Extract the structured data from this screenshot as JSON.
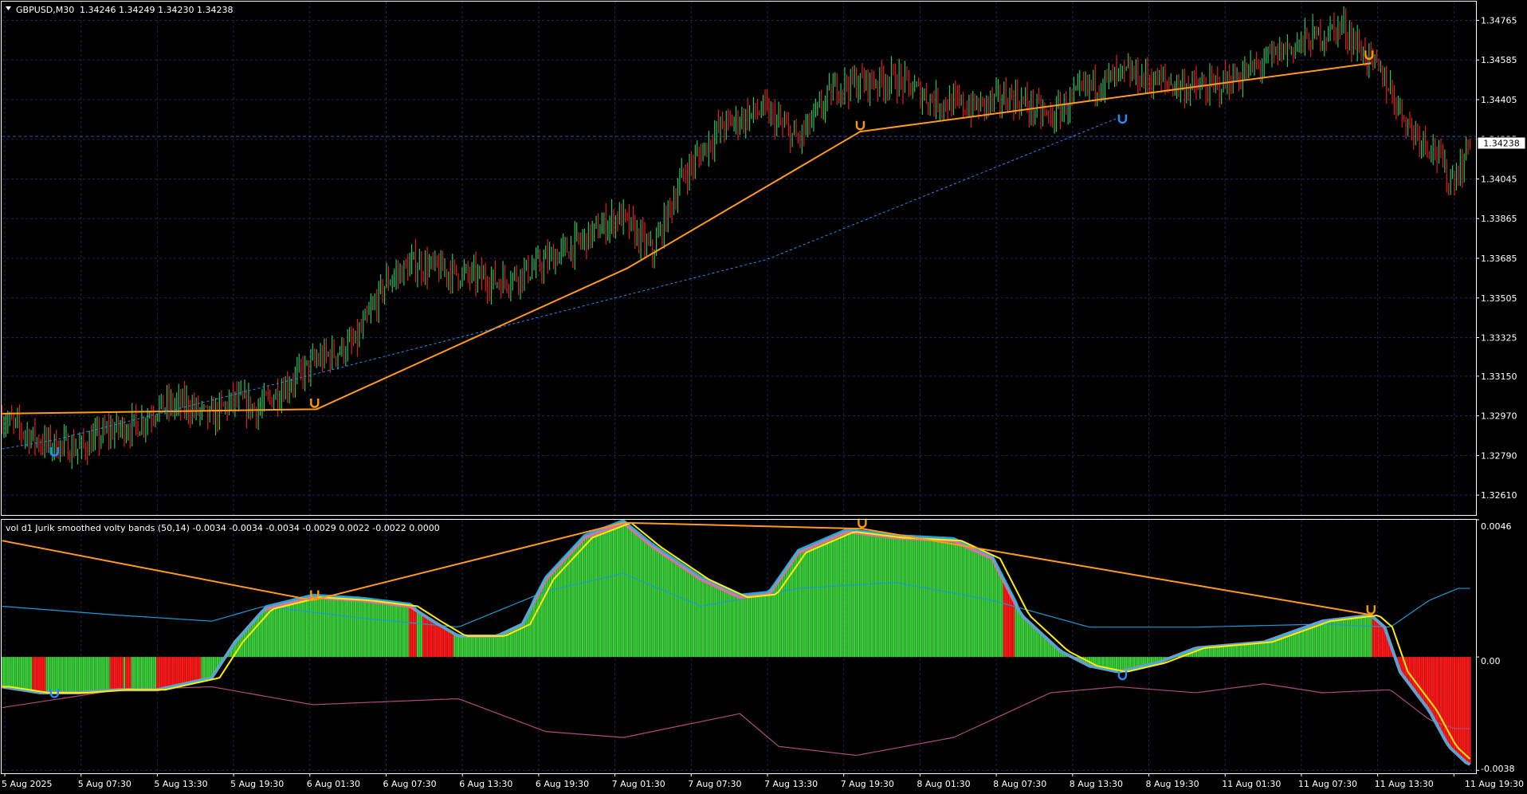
{
  "window": {
    "title": "GBPUSD,M30",
    "quote": "1.34246 1.34249 1.34230 1.34238",
    "current_price": "1.34238"
  },
  "indicator": {
    "title": "vol d1 Jurik smoothed volty bands (50,14) -0.0034 -0.0034 -0.0034 -0.0029 0.0022 -0.0022 0.0000",
    "y_labels": [
      "0.0046",
      "0.00",
      "-0.0038"
    ]
  },
  "chart_data": [
    {
      "type": "candlestick",
      "symbol": "GBPUSD",
      "timeframe": "M30",
      "ylim": [
        1.3252,
        1.3485
      ],
      "y_ticks": [
        "1.34765",
        "1.34585",
        "1.34405",
        "1.34225",
        "1.34045",
        "1.33865",
        "1.33685",
        "1.33505",
        "1.33325",
        "1.33150",
        "1.32970",
        "1.32790",
        "1.32610"
      ],
      "x_ticks": [
        "5 Aug 2025",
        "5 Aug 07:30",
        "5 Aug 13:30",
        "5 Aug 19:30",
        "6 Aug 01:30",
        "6 Aug 07:30",
        "6 Aug 13:30",
        "6 Aug 19:30",
        "7 Aug 01:30",
        "7 Aug 07:30",
        "7 Aug 13:30",
        "7 Aug 19:30",
        "8 Aug 01:30",
        "8 Aug 07:30",
        "8 Aug 13:30",
        "8 Aug 19:30",
        "11 Aug 01:30",
        "11 Aug 07:30",
        "11 Aug 13:30",
        "11 Aug 19:30"
      ],
      "current_price": 1.34238,
      "bull_color": "#22c55e",
      "bear_color": "#e11d1d",
      "close_path": [
        [
          0,
          1.3296
        ],
        [
          20,
          1.3285
        ],
        [
          40,
          1.3282
        ],
        [
          55,
          1.329
        ],
        [
          70,
          1.3293
        ],
        [
          80,
          1.3301
        ],
        [
          95,
          1.3302
        ],
        [
          107,
          1.3296
        ],
        [
          120,
          1.3304
        ],
        [
          132,
          1.33
        ],
        [
          145,
          1.331
        ],
        [
          162,
          1.3322
        ],
        [
          182,
          1.333
        ],
        [
          198,
          1.3358
        ],
        [
          212,
          1.3366
        ],
        [
          232,
          1.3362
        ],
        [
          256,
          1.3358
        ],
        [
          274,
          1.3364
        ],
        [
          298,
          1.3376
        ],
        [
          318,
          1.3388
        ],
        [
          335,
          1.3371
        ],
        [
          350,
          1.3405
        ],
        [
          370,
          1.3428
        ],
        [
          392,
          1.3436
        ],
        [
          410,
          1.3422
        ],
        [
          430,
          1.3447
        ],
        [
          460,
          1.345
        ],
        [
          480,
          1.344
        ],
        [
          500,
          1.3437
        ],
        [
          520,
          1.3442
        ],
        [
          540,
          1.3432
        ],
        [
          560,
          1.3447
        ],
        [
          580,
          1.3452
        ],
        [
          600,
          1.3448
        ],
        [
          620,
          1.3445
        ],
        [
          640,
          1.3452
        ],
        [
          660,
          1.3463
        ],
        [
          680,
          1.347
        ],
        [
          690,
          1.3474
        ],
        [
          700,
          1.3463
        ],
        [
          712,
          1.345
        ],
        [
          725,
          1.3428
        ],
        [
          738,
          1.3418
        ],
        [
          745,
          1.3404
        ],
        [
          752,
          1.341
        ],
        [
          756,
          1.3424
        ]
      ],
      "zigzag": [
        [
          0,
          1.3298
        ],
        [
          162,
          1.33
        ],
        [
          322,
          1.3364
        ],
        [
          442,
          1.3426
        ],
        [
          705,
          1.3457
        ]
      ],
      "dashed": [
        [
          0,
          1.3282
        ],
        [
          27,
          1.3286
        ],
        [
          394,
          1.3368
        ],
        [
          577,
          1.3433
        ]
      ],
      "arrows": [
        {
          "x": 27,
          "price": 1.3281,
          "color": "#1e90ff"
        },
        {
          "x": 161,
          "price": 1.3303,
          "color": "#ff9900"
        },
        {
          "x": 442,
          "price": 1.3429,
          "color": "#ff9900"
        },
        {
          "x": 577,
          "price": 1.3432,
          "color": "#1e90ff"
        },
        {
          "x": 704,
          "price": 1.3461,
          "color": "#ff9900"
        }
      ]
    },
    {
      "type": "histogram",
      "name": "vol d1 Jurik smoothed volty bands (50,14)",
      "ylim": [
        -0.0039,
        0.0046
      ],
      "y_ticks": [
        0.0046,
        0.0,
        -0.0038
      ],
      "pos_color": "#3ccf3c",
      "neg_color": "#ff1a1a",
      "values_path": [
        [
          0,
          -0.001
        ],
        [
          20,
          -0.0012
        ],
        [
          40,
          -0.0012
        ],
        [
          60,
          -0.0011
        ],
        [
          80,
          -0.0011
        ],
        [
          108,
          -0.0007
        ],
        [
          120,
          0.0005
        ],
        [
          135,
          0.0016
        ],
        [
          160,
          0.002
        ],
        [
          185,
          0.0019
        ],
        [
          210,
          0.0017
        ],
        [
          222,
          0.0012
        ],
        [
          235,
          0.0007
        ],
        [
          255,
          0.0007
        ],
        [
          268,
          0.0011
        ],
        [
          280,
          0.0026
        ],
        [
          300,
          0.004
        ],
        [
          320,
          0.0045
        ],
        [
          335,
          0.0037
        ],
        [
          360,
          0.0026
        ],
        [
          380,
          0.002
        ],
        [
          395,
          0.0021
        ],
        [
          410,
          0.0035
        ],
        [
          435,
          0.0042
        ],
        [
          460,
          0.004
        ],
        [
          490,
          0.0039
        ],
        [
          510,
          0.0033
        ],
        [
          525,
          0.0014
        ],
        [
          545,
          0.0002
        ],
        [
          560,
          -0.0003
        ],
        [
          575,
          -0.0005
        ],
        [
          595,
          -0.0002
        ],
        [
          615,
          0.0003
        ],
        [
          650,
          0.0005
        ],
        [
          680,
          0.0012
        ],
        [
          705,
          0.0014
        ],
        [
          712,
          0.001
        ],
        [
          720,
          -0.0005
        ],
        [
          735,
          -0.0018
        ],
        [
          745,
          -0.003
        ],
        [
          755,
          -0.0036
        ]
      ],
      "negative_spans": [
        [
          16,
          22
        ],
        [
          56,
          62
        ],
        [
          64,
          66
        ],
        [
          80,
          102
        ],
        [
          210,
          213
        ],
        [
          217,
          232
        ],
        [
          516,
          521
        ],
        [
          706,
          756
        ]
      ],
      "zigzag": [
        [
          0,
          0.0039
        ],
        [
          160,
          0.0019
        ],
        [
          320,
          0.0045
        ],
        [
          443,
          0.0043
        ],
        [
          706,
          0.0014
        ]
      ],
      "arrows": [
        {
          "x": 27,
          "value": -0.0012,
          "color": "#1e90ff"
        },
        {
          "x": 161,
          "value": 0.0021,
          "color": "#ff9900"
        },
        {
          "x": 443,
          "value": 0.0045,
          "color": "#ff9900"
        },
        {
          "x": 577,
          "value": -0.0006,
          "color": "#1e90ff"
        },
        {
          "x": 705,
          "value": 0.0016,
          "color": "#ff9900"
        }
      ],
      "upper_band_path": [
        [
          0,
          0.0017
        ],
        [
          60,
          0.0014
        ],
        [
          108,
          0.0012
        ],
        [
          135,
          0.0017
        ],
        [
          185,
          0.0013
        ],
        [
          235,
          0.001
        ],
        [
          280,
          0.0022
        ],
        [
          320,
          0.0028
        ],
        [
          360,
          0.0017
        ],
        [
          410,
          0.0023
        ],
        [
          460,
          0.0025
        ],
        [
          510,
          0.0019
        ],
        [
          560,
          0.001
        ],
        [
          615,
          0.001
        ],
        [
          680,
          0.0011
        ],
        [
          715,
          0.001
        ],
        [
          735,
          0.0019
        ],
        [
          750,
          0.0023
        ]
      ],
      "lower_band_path": [
        [
          0,
          -0.0017
        ],
        [
          60,
          -0.0011
        ],
        [
          108,
          -0.001
        ],
        [
          160,
          -0.0016
        ],
        [
          235,
          -0.0014
        ],
        [
          280,
          -0.0025
        ],
        [
          320,
          -0.0027
        ],
        [
          380,
          -0.0019
        ],
        [
          400,
          -0.003
        ],
        [
          440,
          -0.0033
        ],
        [
          490,
          -0.0027
        ],
        [
          540,
          -0.0012
        ],
        [
          575,
          -0.001
        ],
        [
          615,
          -0.0012
        ],
        [
          650,
          -0.0009
        ],
        [
          680,
          -0.0012
        ],
        [
          715,
          -0.0011
        ],
        [
          735,
          -0.0021
        ],
        [
          748,
          -0.0024
        ]
      ]
    }
  ]
}
